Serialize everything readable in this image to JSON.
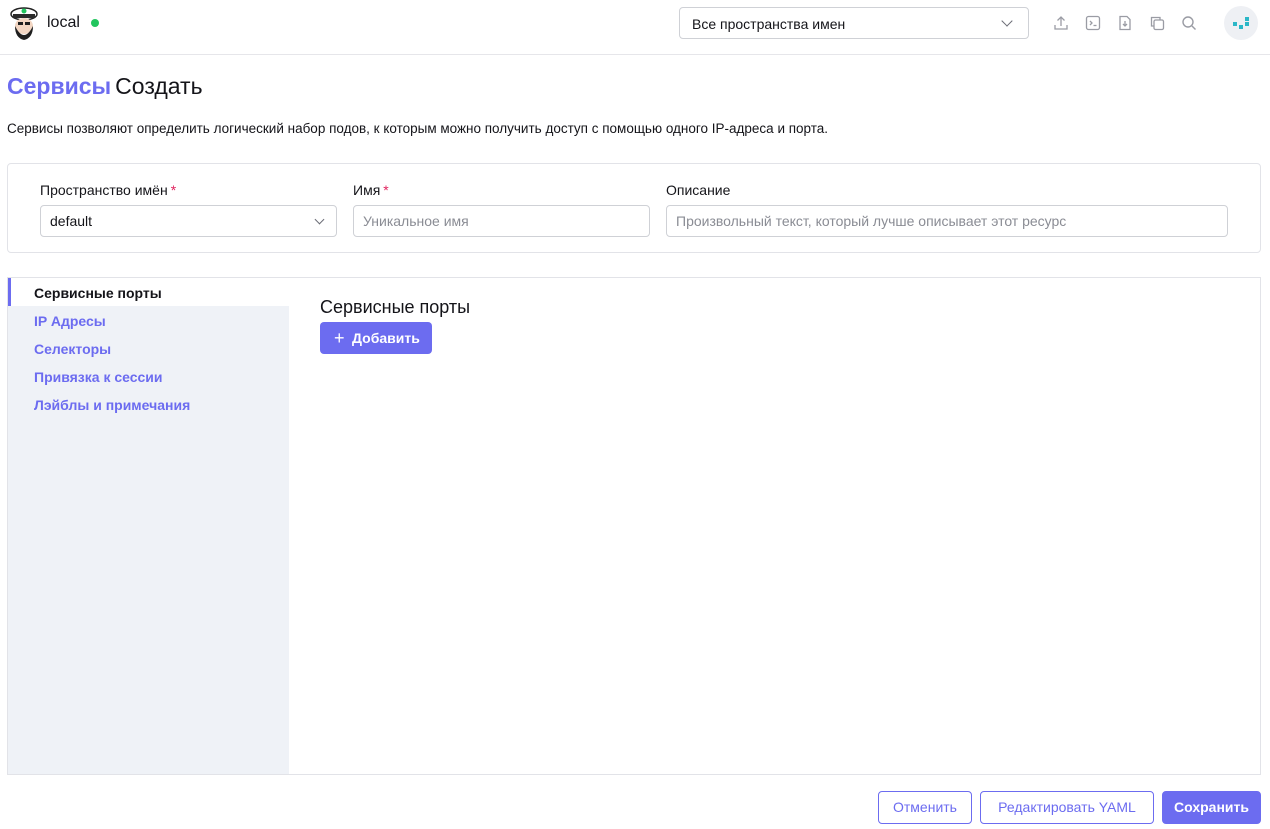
{
  "header": {
    "cluster_name": "local",
    "namespace_select": "Все пространства имен",
    "icons": [
      "upload-icon",
      "terminal-icon",
      "import-yaml-icon",
      "copy-icon",
      "search-icon",
      "avatar"
    ]
  },
  "page": {
    "resource": "Сервисы",
    "action": "Создать",
    "description": "Сервисы позволяют определить логический набор подов, к которым можно получить доступ с помощью одного IP-адреса и порта."
  },
  "form": {
    "namespace_label": "Пространство имён",
    "namespace_value": "default",
    "name_label": "Имя",
    "name_placeholder": "Уникальное имя",
    "description_label": "Описание",
    "description_placeholder": "Произвольный текст, который лучше описывает этот ресурс",
    "required_mark": "*"
  },
  "tabs": [
    {
      "label": "Сервисные порты",
      "active": true
    },
    {
      "label": "IP Адресы",
      "active": false
    },
    {
      "label": "Селекторы",
      "active": false
    },
    {
      "label": "Привязка к сессии",
      "active": false
    },
    {
      "label": "Лэйблы и примечания",
      "active": false
    }
  ],
  "content": {
    "section_title": "Сервисные порты",
    "add_label": "Добавить",
    "add_icon": "+"
  },
  "footer": {
    "cancel": "Отменить",
    "edit_yaml": "Редактировать YAML",
    "save": "Сохранить"
  },
  "colors": {
    "accent": "#6c6cf0",
    "status_online": "#22c55e",
    "required": "#e0245e",
    "sidebar_bg": "#eff2f7"
  }
}
